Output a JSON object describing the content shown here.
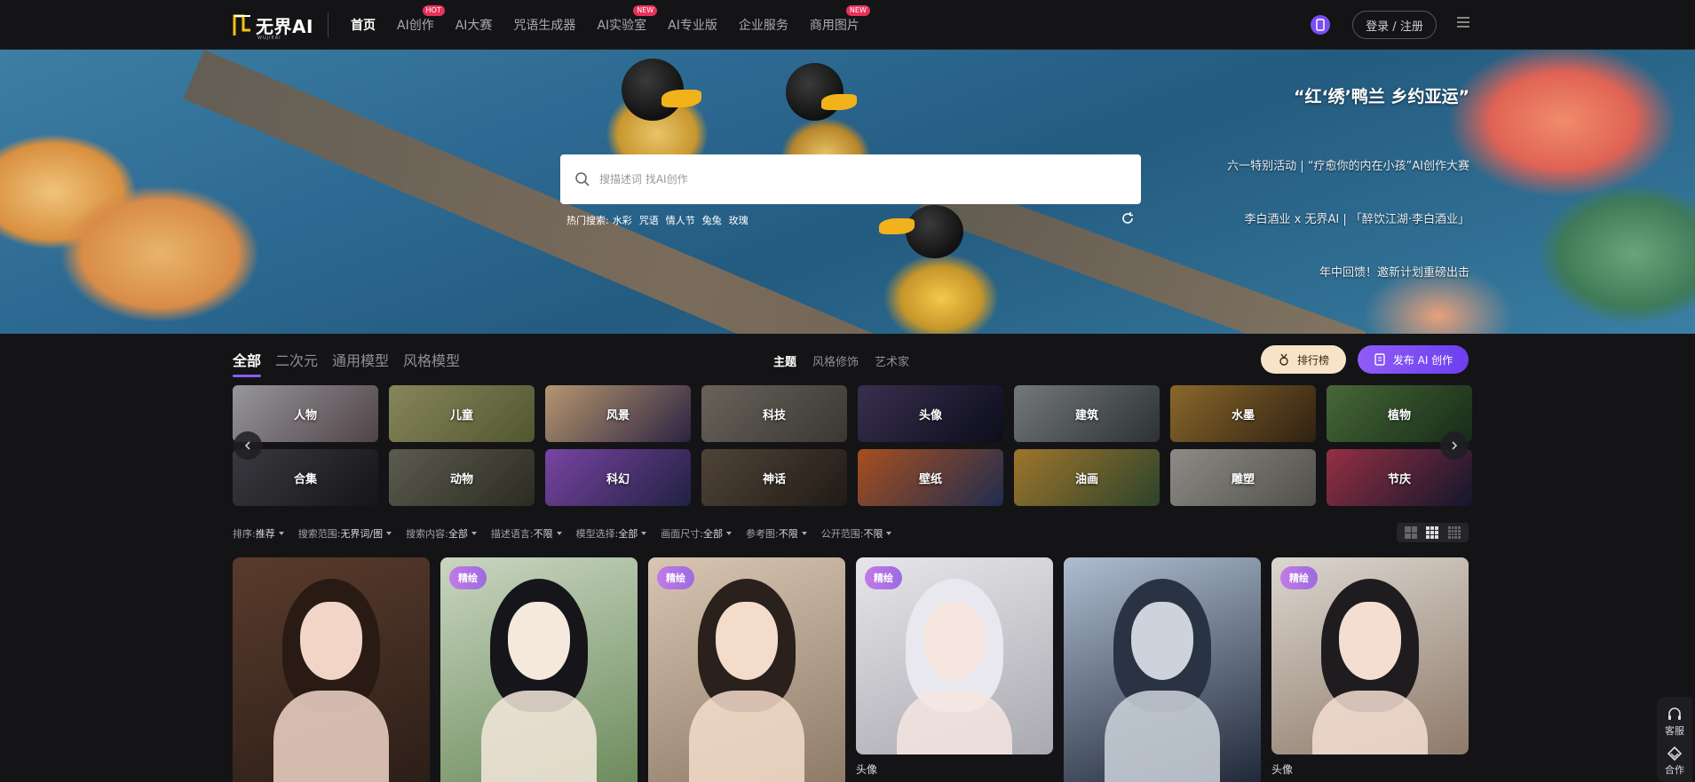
{
  "nav": {
    "logo_text": "无界AI",
    "logo_sub": "WUJIEAI",
    "links": [
      {
        "label": "首页",
        "active": true,
        "badge": ""
      },
      {
        "label": "AI创作",
        "active": false,
        "badge": "HOT"
      },
      {
        "label": "AI大赛",
        "active": false,
        "badge": ""
      },
      {
        "label": "咒语生成器",
        "active": false,
        "badge": ""
      },
      {
        "label": "AI实验室",
        "active": false,
        "badge": "NEW"
      },
      {
        "label": "AI专业版",
        "active": false,
        "badge": ""
      },
      {
        "label": "企业服务",
        "active": false,
        "badge": ""
      },
      {
        "label": "商用图片",
        "active": false,
        "badge": "NEW"
      }
    ],
    "login_label": "登录 / 注册"
  },
  "hero": {
    "search_placeholder": "搜描述词 找AI创作",
    "hot_label": "热门搜索:",
    "hot_items": [
      "水彩",
      "咒语",
      "情人节",
      "兔兔",
      "玫瑰"
    ],
    "titles": [
      "“红‘绣’鸭兰 乡约亚运”",
      "六一特别活动 | “疗愈你的内在小孩”AI创作大赛",
      "李白酒业 x 无界AI | 「醉饮江湖·李白酒业」",
      "年中回馈！邀新计划重磅出击"
    ]
  },
  "category_tabs": [
    {
      "label": "全部",
      "active": true
    },
    {
      "label": "二次元",
      "active": false
    },
    {
      "label": "通用模型",
      "active": false
    },
    {
      "label": "风格模型",
      "active": false
    }
  ],
  "mid_tabs": [
    {
      "label": "主题",
      "active": true
    },
    {
      "label": "风格修饰",
      "active": false
    },
    {
      "label": "艺术家",
      "active": false
    }
  ],
  "buttons": {
    "rank": "排行榜",
    "publish": "发布 AI 创作"
  },
  "tiles": [
    {
      "label": "人物",
      "colors": [
        "#c9c9cf",
        "#6b5a60"
      ]
    },
    {
      "label": "儿童",
      "colors": [
        "#b4b37a",
        "#6d7440"
      ]
    },
    {
      "label": "风景",
      "colors": [
        "#f2c995",
        "#3c2f58"
      ]
    },
    {
      "label": "科技",
      "colors": [
        "#8b8579",
        "#4e4a44"
      ]
    },
    {
      "label": "头像",
      "colors": [
        "#4c3f68",
        "#101225"
      ]
    },
    {
      "label": "建筑",
      "colors": [
        "#9aa0a4",
        "#3c4346"
      ]
    },
    {
      "label": "水墨",
      "colors": [
        "#b98a3c",
        "#3f2c16"
      ]
    },
    {
      "label": "植物",
      "colors": [
        "#5f8a4a",
        "#1f3a20"
      ]
    },
    {
      "label": "合集",
      "colors": [
        "#4d4d55",
        "#1c1c22"
      ]
    },
    {
      "label": "动物",
      "colors": [
        "#7a7a6a",
        "#3a3a2e"
      ]
    },
    {
      "label": "科幻",
      "colors": [
        "#a25bd8",
        "#2c2d5a"
      ]
    },
    {
      "label": "神话",
      "colors": [
        "#6a5a4a",
        "#2c241d"
      ]
    },
    {
      "label": "壁纸",
      "colors": [
        "#e06a2a",
        "#2a3c6a"
      ]
    },
    {
      "label": "油画",
      "colors": [
        "#d39d3a",
        "#3b5a3a"
      ]
    },
    {
      "label": "雕塑",
      "colors": [
        "#bdbab2",
        "#6c6a62"
      ]
    },
    {
      "label": "节庆",
      "colors": [
        "#c7405a",
        "#1a1e3a"
      ]
    }
  ],
  "filters": [
    {
      "label": "排序:",
      "value": "推荐"
    },
    {
      "label": "搜索范围:",
      "value": "无界词/图"
    },
    {
      "label": "搜索内容:",
      "value": "全部"
    },
    {
      "label": "描述语言:",
      "value": "不限"
    },
    {
      "label": "模型选择:",
      "value": "全部"
    },
    {
      "label": "画面尺寸:",
      "value": "全部"
    },
    {
      "label": "参考图:",
      "value": "不限"
    },
    {
      "label": "公开范围:",
      "value": "不限"
    }
  ],
  "cards": [
    {
      "badge": "",
      "title": "",
      "bg": [
        "#5a3b2c",
        "#2a1e18"
      ],
      "skin": "#f1d6c8",
      "hair": "#2a1a14"
    },
    {
      "badge": "精绘",
      "title": "",
      "bg": [
        "#c9d6c1",
        "#6b8a5a"
      ],
      "skin": "#f5e8dc",
      "hair": "#15151a"
    },
    {
      "badge": "精绘",
      "title": "",
      "bg": [
        "#d8c6b2",
        "#8c7a66"
      ],
      "skin": "#f4dccb",
      "hair": "#2a201c"
    },
    {
      "badge": "精绘",
      "title": "头像",
      "bg": [
        "#e6e6ea",
        "#a9a9b0"
      ],
      "skin": "#f6e6e0",
      "hair": "#e8e8ee"
    },
    {
      "badge": "",
      "title": "",
      "bg": [
        "#aebdd0",
        "#1e2636"
      ],
      "skin": "#cdd3dc",
      "hair": "#2a3344"
    },
    {
      "badge": "精绘",
      "title": "头像",
      "bg": [
        "#dcd6cf",
        "#8e7a6a"
      ],
      "skin": "#f4ded2",
      "hair": "#1e1c1e"
    }
  ],
  "side": {
    "service": "客服",
    "cooperate": "合作"
  }
}
